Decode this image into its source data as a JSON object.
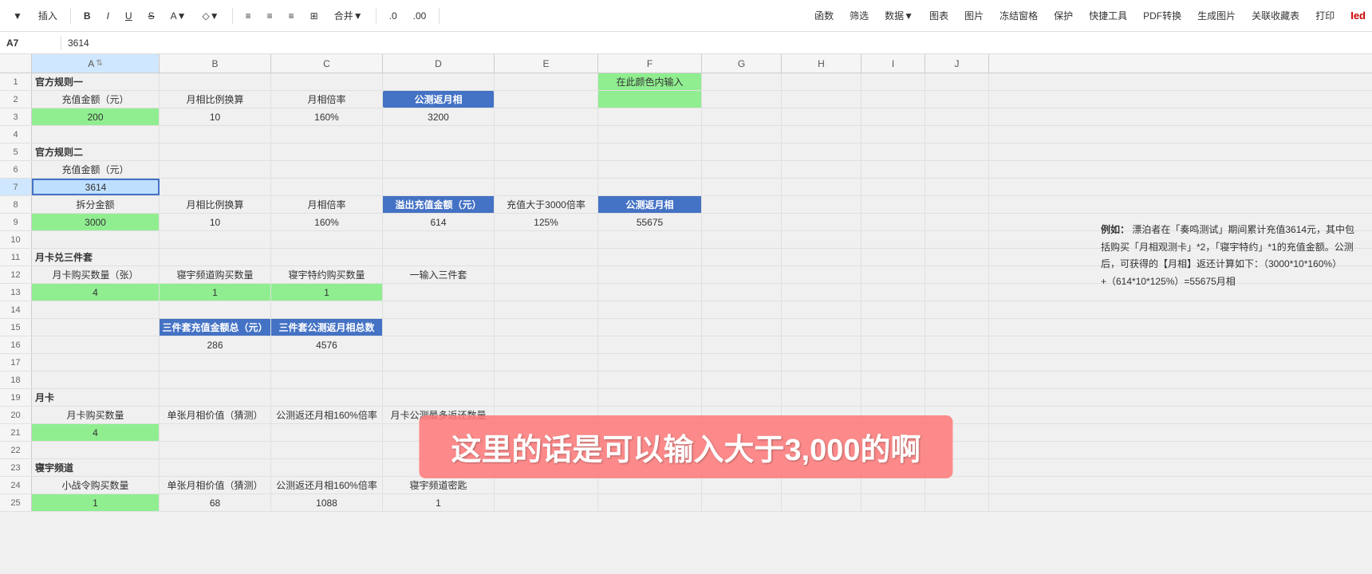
{
  "toolbar": {
    "cell_ref": "A7",
    "formula_value": "3614",
    "buttons": [
      "▼",
      "插入",
      "B",
      "I",
      "U",
      "S",
      "A▼",
      "◇▼",
      "≡",
      "≡",
      "≡",
      "⊞",
      "合并▼"
    ],
    "right_buttons": [
      "函数",
      "筛选",
      "数据▼",
      "图表",
      "图片",
      "冻结窗格",
      "保护",
      "快捷工具",
      "PDF转换",
      "生成图片",
      "关联收藏表",
      "打印"
    ]
  },
  "columns": [
    "A",
    "B",
    "C",
    "D",
    "E",
    "F",
    "G",
    "H",
    "I",
    "J"
  ],
  "rows": [
    {
      "num": 1,
      "cells": {
        "a": "官方规则一",
        "b": "",
        "c": "",
        "d": "",
        "e": "",
        "f": "在此颜色内输入",
        "g": "",
        "h": "",
        "i": "",
        "j": ""
      }
    },
    {
      "num": 2,
      "cells": {
        "a": "充值金额（元）",
        "b": "月相比例换算",
        "c": "月相倍率",
        "d": "公测返月相",
        "e": "",
        "f": "",
        "g": "",
        "h": "",
        "i": "",
        "j": ""
      }
    },
    {
      "num": 3,
      "cells": {
        "a": "200",
        "b": "10",
        "c": "160%",
        "d": "3200",
        "e": "",
        "f": "",
        "g": "",
        "h": "",
        "i": "",
        "j": ""
      }
    },
    {
      "num": 4,
      "cells": {
        "a": "",
        "b": "",
        "c": "",
        "d": "",
        "e": "",
        "f": "",
        "g": "",
        "h": "",
        "i": "",
        "j": ""
      }
    },
    {
      "num": 5,
      "cells": {
        "a": "官方规则二",
        "b": "",
        "c": "",
        "d": "",
        "e": "",
        "f": "",
        "g": "",
        "h": "",
        "i": "",
        "j": ""
      }
    },
    {
      "num": 6,
      "cells": {
        "a": "充值金额（元）",
        "b": "",
        "c": "",
        "d": "",
        "e": "",
        "f": "",
        "g": "",
        "h": "",
        "i": "",
        "j": ""
      }
    },
    {
      "num": 7,
      "cells": {
        "a": "3614",
        "b": "",
        "c": "",
        "d": "",
        "e": "",
        "f": "",
        "g": "",
        "h": "",
        "i": "",
        "j": ""
      }
    },
    {
      "num": 8,
      "cells": {
        "a": "拆分金额",
        "b": "月相比例换算",
        "c": "月相倍率",
        "d": "溢出充值金额（元）",
        "e": "充值大于3000倍率",
        "f": "公测返月相",
        "g": "",
        "h": "",
        "i": "",
        "j": ""
      }
    },
    {
      "num": 9,
      "cells": {
        "a": "3000",
        "b": "10",
        "c": "160%",
        "d": "614",
        "e": "125%",
        "f": "55675",
        "g": "",
        "h": "",
        "i": "",
        "j": ""
      }
    },
    {
      "num": 10,
      "cells": {
        "a": "",
        "b": "",
        "c": "",
        "d": "",
        "e": "",
        "f": "",
        "g": "",
        "h": "",
        "i": "",
        "j": ""
      }
    },
    {
      "num": 11,
      "cells": {
        "a": "月卡兑三件套",
        "b": "",
        "c": "",
        "d": "",
        "e": "",
        "f": "",
        "g": "",
        "h": "",
        "i": "",
        "j": ""
      }
    },
    {
      "num": 12,
      "cells": {
        "a": "月卡购买数量（张）",
        "b": "寝宇频道购买数量",
        "c": "寝宇特约购买数量",
        "d": "一输入三件套",
        "e": "",
        "f": "",
        "g": "",
        "h": "",
        "i": "",
        "j": ""
      }
    },
    {
      "num": 13,
      "cells": {
        "a": "4",
        "b": "1",
        "c": "1",
        "d": "",
        "e": "",
        "f": "",
        "g": "",
        "h": "",
        "i": "",
        "j": ""
      }
    },
    {
      "num": 14,
      "cells": {
        "a": "",
        "b": "",
        "c": "",
        "d": "",
        "e": "",
        "f": "",
        "g": "",
        "h": "",
        "i": "",
        "j": ""
      }
    },
    {
      "num": 15,
      "cells": {
        "a": "",
        "b": "三件套充值金额总（元）",
        "c": "三件套公测返月相总数",
        "d": "",
        "e": "",
        "f": "",
        "g": "",
        "h": "",
        "i": "",
        "j": ""
      }
    },
    {
      "num": 16,
      "cells": {
        "a": "",
        "b": "286",
        "c": "4576",
        "d": "",
        "e": "",
        "f": "",
        "g": "",
        "h": "",
        "i": "",
        "j": ""
      }
    },
    {
      "num": 17,
      "cells": {
        "a": "",
        "b": "",
        "c": "",
        "d": "",
        "e": "",
        "f": "",
        "g": "",
        "h": "",
        "i": "",
        "j": ""
      }
    },
    {
      "num": 18,
      "cells": {
        "a": "",
        "b": "",
        "c": "",
        "d": "",
        "e": "",
        "f": "",
        "g": "",
        "h": "",
        "i": "",
        "j": ""
      }
    },
    {
      "num": 19,
      "cells": {
        "a": "月卡",
        "b": "",
        "c": "",
        "d": "",
        "e": "",
        "f": "",
        "g": "",
        "h": "",
        "i": "",
        "j": ""
      }
    },
    {
      "num": 20,
      "cells": {
        "a": "月卡购买数量",
        "b": "单张月相价值（猜测）",
        "c": "公测返还月相160%倍率",
        "d": "月卡公测最多返还数量",
        "e": "",
        "f": "",
        "g": "",
        "h": "",
        "i": "",
        "j": ""
      }
    },
    {
      "num": 21,
      "cells": {
        "a": "4",
        "b": "",
        "c": "",
        "d": "",
        "e": "",
        "f": "",
        "g": "",
        "h": "",
        "i": "",
        "j": ""
      }
    },
    {
      "num": 22,
      "cells": {
        "a": "",
        "b": "",
        "c": "",
        "d": "",
        "e": "",
        "f": "",
        "g": "",
        "h": "",
        "i": "",
        "j": ""
      }
    },
    {
      "num": 23,
      "cells": {
        "a": "寝宇频道",
        "b": "",
        "c": "",
        "d": "",
        "e": "",
        "f": "",
        "g": "",
        "h": "",
        "i": "",
        "j": ""
      }
    },
    {
      "num": 24,
      "cells": {
        "a": "小战令购买数量",
        "b": "单张月相价值（猜测）",
        "c": "公测返还月相160%倍率",
        "d": "寝宇频道密匙",
        "e": "",
        "f": "",
        "g": "",
        "h": "",
        "i": "",
        "j": ""
      }
    },
    {
      "num": 25,
      "cells": {
        "a": "1",
        "b": "68",
        "c": "1088",
        "d": "1",
        "e": "",
        "f": "",
        "g": "",
        "h": "",
        "i": "",
        "j": ""
      }
    }
  ],
  "side_note": {
    "label": "例如：",
    "text": "漂泊者在「奏鸣测试」期间累计充值3614元，其中包括购买「月相观测卡」*2，「寝宇特约」*1的充值金额。公测后，可获得的【月相】返还计算如下：（3000*10*160%）+（614*10*125%）=55675月相"
  },
  "subtitle": "这里的话是可以输入大于3,000的啊",
  "colors": {
    "green": "#90EE90",
    "blue": "#4472C4",
    "light_green": "#c6efce",
    "selected": "#BFDFFF"
  }
}
